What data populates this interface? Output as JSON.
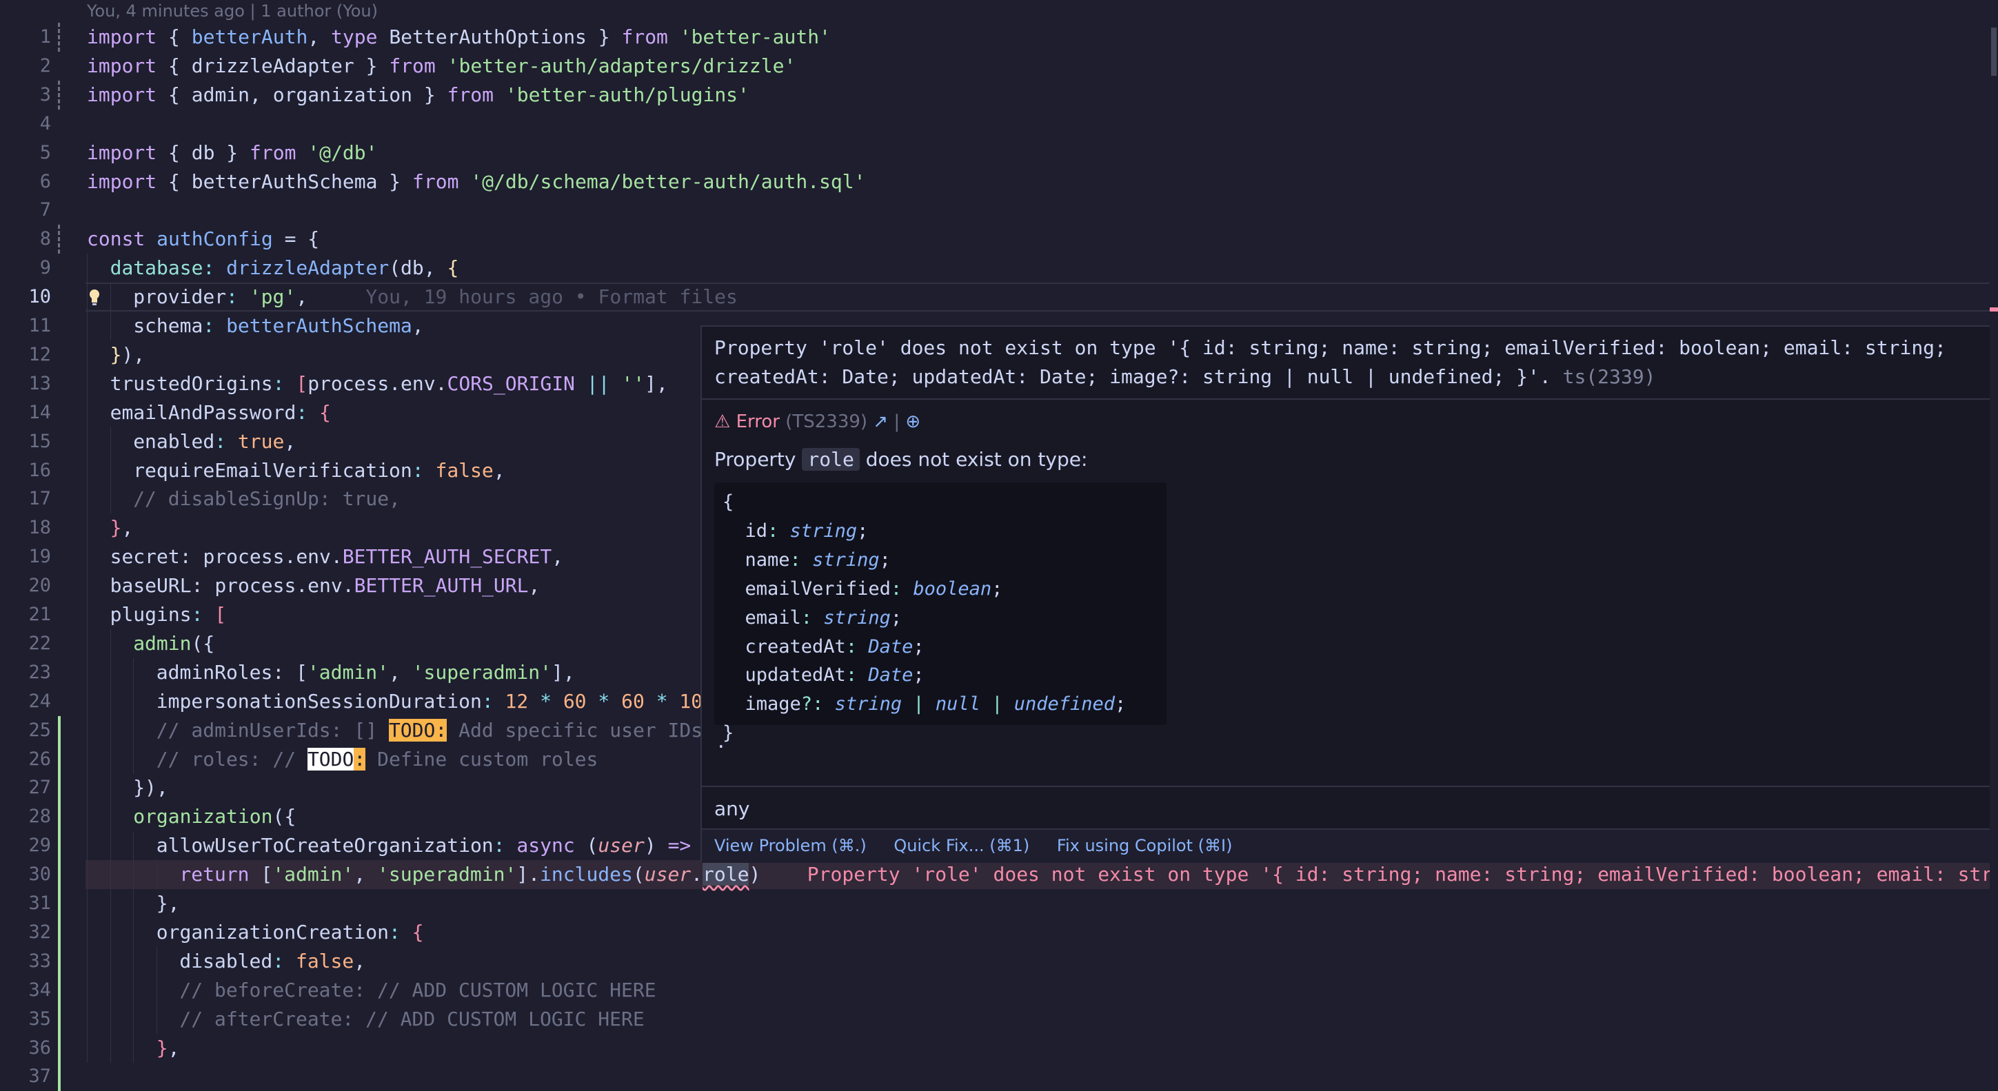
{
  "blame_header": "You, 4 minutes ago | 1 author (You)",
  "inline_blame": "You, 19 hours ago • Format files",
  "inline_error": "Property 'role' does not exist on type '{ id: string; name: string; emailVerified: boolean; email: stri",
  "line_numbers": [
    "1",
    "2",
    "3",
    "4",
    "5",
    "6",
    "7",
    "8",
    "9",
    "10",
    "11",
    "12",
    "13",
    "14",
    "15",
    "16",
    "17",
    "18",
    "19",
    "20",
    "21",
    "22",
    "23",
    "24",
    "25",
    "26",
    "27",
    "28",
    "29",
    "30",
    "31",
    "32",
    "33",
    "34",
    "35",
    "36",
    "37"
  ],
  "code": {
    "l1": [
      "import",
      " { ",
      "betterAuth",
      ", ",
      "type",
      " BetterAuthOptions } ",
      "from",
      " ",
      "'better-auth'"
    ],
    "l2": [
      "import",
      " { drizzleAdapter } ",
      "from",
      " ",
      "'better-auth/adapters/drizzle'"
    ],
    "l3": [
      "import",
      " { admin, organization } ",
      "from",
      " ",
      "'better-auth/plugins'"
    ],
    "l5": [
      "import",
      " { db } ",
      "from",
      " ",
      "'@/db'"
    ],
    "l6": [
      "import",
      " { betterAuthSchema } ",
      "from",
      " ",
      "'@/db/schema/better-auth/auth.sql'"
    ],
    "l8": [
      "const",
      " ",
      "authConfig",
      " = {"
    ],
    "l9": [
      "database",
      ": ",
      "drizzleAdapter",
      "(db, ",
      "{"
    ],
    "l10": [
      "provider",
      ": ",
      "'pg'",
      ","
    ],
    "l11": [
      "schema",
      ": ",
      "betterAuthSchema",
      ","
    ],
    "l12": [
      "}",
      "),"
    ],
    "l13": [
      "trustedOrigins",
      ": ",
      "[",
      "process.env.",
      "CORS_ORIGIN",
      " || ",
      "''",
      "],"
    ],
    "l14": [
      "emailAndPassword",
      ": ",
      "{"
    ],
    "l15": [
      "enabled",
      ": ",
      "true",
      ","
    ],
    "l16": [
      "requireEmailVerification",
      ": ",
      "false",
      ","
    ],
    "l17": [
      "// disableSignUp: true,"
    ],
    "l18": [
      "}",
      ","
    ],
    "l19": [
      "secret",
      ": process.env.",
      "BETTER_AUTH_SECRET",
      ","
    ],
    "l20": [
      "baseURL",
      ": process.env.",
      "BETTER_AUTH_URL",
      ","
    ],
    "l21": [
      "plugins",
      ": ",
      "["
    ],
    "l22": [
      "admin",
      "({"
    ],
    "l23": [
      "adminRoles",
      ": [",
      "'admin'",
      ", ",
      "'superadmin'",
      "],"
    ],
    "l24": [
      "impersonationSessionDuration",
      ": ",
      "12",
      " * ",
      "60",
      " * ",
      "60",
      " * ",
      "10"
    ],
    "l25": [
      "// adminUserIds: [] ",
      "TODO:",
      " Add specific user IDs"
    ],
    "l26": [
      "// roles: // ",
      "TODO",
      ":",
      " Define custom roles"
    ],
    "l27": [
      "}",
      "),"
    ],
    "l28": [
      "organization",
      "({"
    ],
    "l29": [
      "allowUserToCreateOrganization",
      ": ",
      "async",
      " (",
      "user",
      ") ",
      "=>"
    ],
    "l30": [
      "return",
      " [",
      "'admin'",
      ", ",
      "'superadmin'",
      "].",
      "includes",
      "(",
      "user",
      ".",
      "role",
      ")"
    ],
    "l31": [
      "}",
      ","
    ],
    "l32": [
      "organizationCreation",
      ": ",
      "{"
    ],
    "l33": [
      "disabled",
      ": ",
      "false",
      ","
    ],
    "l34": [
      "// beforeCreate: // ADD CUSTOM LOGIC HERE"
    ],
    "l35": [
      "// afterCreate: // ADD CUSTOM LOGIC HERE"
    ],
    "l36": [
      "}",
      ","
    ]
  },
  "hover": {
    "message_line1": "Property 'role' does not exist on type '{ id: string; name: string; emailVerified: boolean; email: string;",
    "message_line2": "createdAt: Date; updatedAt: Date; image?: string | null | undefined; }'.",
    "message_code": "ts(2339)",
    "error_label": "Error",
    "error_code": "(TS2339)",
    "desc_prefix": "Property",
    "desc_prop": "role",
    "desc_suffix": "does not exist on type:",
    "type_open": "{",
    "type_fields": [
      {
        "name": "id",
        "type": "string"
      },
      {
        "name": "name",
        "type": "string"
      },
      {
        "name": "emailVerified",
        "type": "boolean"
      },
      {
        "name": "email",
        "type": "string"
      },
      {
        "name": "createdAt",
        "type": "Date"
      },
      {
        "name": "updatedAt",
        "type": "Date"
      }
    ],
    "image_field": {
      "name": "image",
      "optional": "?",
      "t1": "string",
      "t2": "null",
      "t3": "undefined"
    },
    "type_close": "}",
    "trailing_dot": ".",
    "any_label": "any",
    "actions": {
      "view_problem": "View Problem (⌘.)",
      "quick_fix": "Quick Fix... (⌘1)",
      "fix_copilot": "Fix using Copilot (⌘I)"
    }
  },
  "colors": {
    "background": "#1e1e2e",
    "error": "#f38ba8",
    "keyword": "#cba6f7",
    "string": "#a6e3a1",
    "function": "#89b4fa"
  }
}
